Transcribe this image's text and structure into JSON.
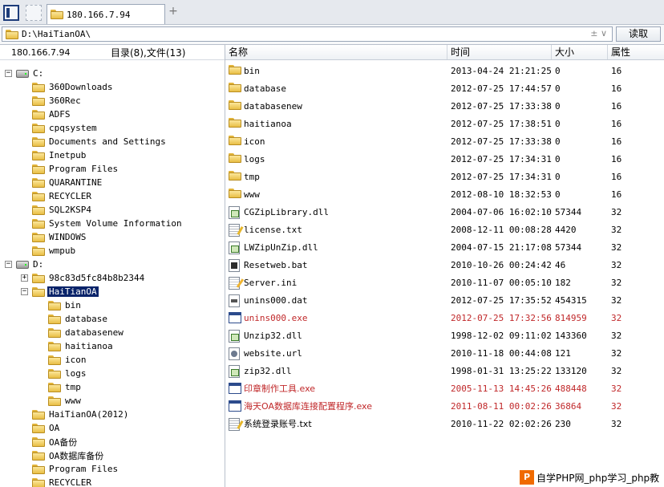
{
  "tab": {
    "title": "180.166.7.94",
    "new_tab": "+"
  },
  "address": {
    "path": "D:\\HaiTianOA\\",
    "read_label": "读取",
    "controls": "± ∨"
  },
  "left_header": {
    "ip": "180.166.7.94",
    "count": "目录(8),文件(13)"
  },
  "tree": [
    {
      "label": "C:",
      "kind": "drive",
      "exp": "−"
    },
    {
      "label": "360Downloads",
      "kind": "folder"
    },
    {
      "label": "360Rec",
      "kind": "folder"
    },
    {
      "label": "ADFS",
      "kind": "folder"
    },
    {
      "label": "cpqsystem",
      "kind": "folder"
    },
    {
      "label": "Documents and Settings",
      "kind": "folder"
    },
    {
      "label": "Inetpub",
      "kind": "folder"
    },
    {
      "label": "Program Files",
      "kind": "folder"
    },
    {
      "label": "QUARANTINE",
      "kind": "folder"
    },
    {
      "label": "RECYCLER",
      "kind": "folder"
    },
    {
      "label": "SQL2KSP4",
      "kind": "folder"
    },
    {
      "label": "System Volume Information",
      "kind": "folder"
    },
    {
      "label": "WINDOWS",
      "kind": "folder"
    },
    {
      "label": "wmpub",
      "kind": "folder"
    },
    {
      "label": "D:",
      "kind": "drive",
      "exp": "−"
    },
    {
      "label": "98c83d5fc84b8b2344",
      "kind": "folder",
      "exp": "+"
    },
    {
      "label": "HaiTianOA",
      "kind": "folder",
      "exp": "−",
      "selected": true
    },
    {
      "label": "bin",
      "kind": "folder",
      "depth": 2
    },
    {
      "label": "database",
      "kind": "folder",
      "depth": 2
    },
    {
      "label": "databasenew",
      "kind": "folder",
      "depth": 2
    },
    {
      "label": "haitianoa",
      "kind": "folder",
      "depth": 2
    },
    {
      "label": "icon",
      "kind": "folder",
      "depth": 2
    },
    {
      "label": "logs",
      "kind": "folder",
      "depth": 2
    },
    {
      "label": "tmp",
      "kind": "folder",
      "depth": 2
    },
    {
      "label": "www",
      "kind": "folder",
      "depth": 2
    },
    {
      "label": "HaiTianOA(2012)",
      "kind": "folder"
    },
    {
      "label": "OA",
      "kind": "folder"
    },
    {
      "label": "OA备份",
      "kind": "folder"
    },
    {
      "label": "OA数据库备份",
      "kind": "folder"
    },
    {
      "label": "Program Files",
      "kind": "folder"
    },
    {
      "label": "RECYCLER",
      "kind": "folder"
    }
  ],
  "columns": {
    "name": "名称",
    "time": "时间",
    "size": "大小",
    "attr": "属性"
  },
  "files": [
    {
      "name": "bin",
      "time": "2013-04-24 21:21:25",
      "size": "0",
      "attr": "16",
      "icon": "folder"
    },
    {
      "name": "database",
      "time": "2012-07-25 17:44:57",
      "size": "0",
      "attr": "16",
      "icon": "folder"
    },
    {
      "name": "databasenew",
      "time": "2012-07-25 17:33:38",
      "size": "0",
      "attr": "16",
      "icon": "folder"
    },
    {
      "name": "haitianoa",
      "time": "2012-07-25 17:38:51",
      "size": "0",
      "attr": "16",
      "icon": "folder"
    },
    {
      "name": "icon",
      "time": "2012-07-25 17:33:38",
      "size": "0",
      "attr": "16",
      "icon": "folder"
    },
    {
      "name": "logs",
      "time": "2012-07-25 17:34:31",
      "size": "0",
      "attr": "16",
      "icon": "folder"
    },
    {
      "name": "tmp",
      "time": "2012-07-25 17:34:31",
      "size": "0",
      "attr": "16",
      "icon": "folder"
    },
    {
      "name": "www",
      "time": "2012-08-10 18:32:53",
      "size": "0",
      "attr": "16",
      "icon": "folder"
    },
    {
      "name": "CGZipLibrary.dll",
      "time": "2004-07-06 16:02:10",
      "size": "57344",
      "attr": "32",
      "icon": "dll"
    },
    {
      "name": "license.txt",
      "time": "2008-12-11 00:08:28",
      "size": "4420",
      "attr": "32",
      "icon": "txt"
    },
    {
      "name": "LWZipUnZip.dll",
      "time": "2004-07-15 21:17:08",
      "size": "57344",
      "attr": "32",
      "icon": "dll"
    },
    {
      "name": "Resetweb.bat",
      "time": "2010-10-26 00:24:42",
      "size": "46",
      "attr": "32",
      "icon": "bat"
    },
    {
      "name": "Server.ini",
      "time": "2010-11-07 00:05:10",
      "size": "182",
      "attr": "32",
      "icon": "ini"
    },
    {
      "name": "unins000.dat",
      "time": "2012-07-25 17:35:52",
      "size": "454315",
      "attr": "32",
      "icon": "dat"
    },
    {
      "name": "unins000.exe",
      "time": "2012-07-25 17:32:56",
      "size": "814959",
      "attr": "32",
      "icon": "exe",
      "red": true
    },
    {
      "name": "Unzip32.dll",
      "time": "1998-12-02 09:11:02",
      "size": "143360",
      "attr": "32",
      "icon": "dll"
    },
    {
      "name": "website.url",
      "time": "2010-11-18 00:44:08",
      "size": "121",
      "attr": "32",
      "icon": "url"
    },
    {
      "name": "zip32.dll",
      "time": "1998-01-31 13:25:22",
      "size": "133120",
      "attr": "32",
      "icon": "dll"
    },
    {
      "name": "印章制作工具.exe",
      "time": "2005-11-13 14:45:26",
      "size": "488448",
      "attr": "32",
      "icon": "exe",
      "red": true
    },
    {
      "name": "海天OA数据库连接配置程序.exe",
      "time": "2011-08-11 00:02:26",
      "size": "36864",
      "attr": "32",
      "icon": "exe",
      "red": true
    },
    {
      "name": "系统登录账号.txt",
      "time": "2010-11-22 02:02:26",
      "size": "230",
      "attr": "32",
      "icon": "txt"
    }
  ],
  "watermark": {
    "logo": "P",
    "text": "自学PHP网_php学习_php教"
  }
}
